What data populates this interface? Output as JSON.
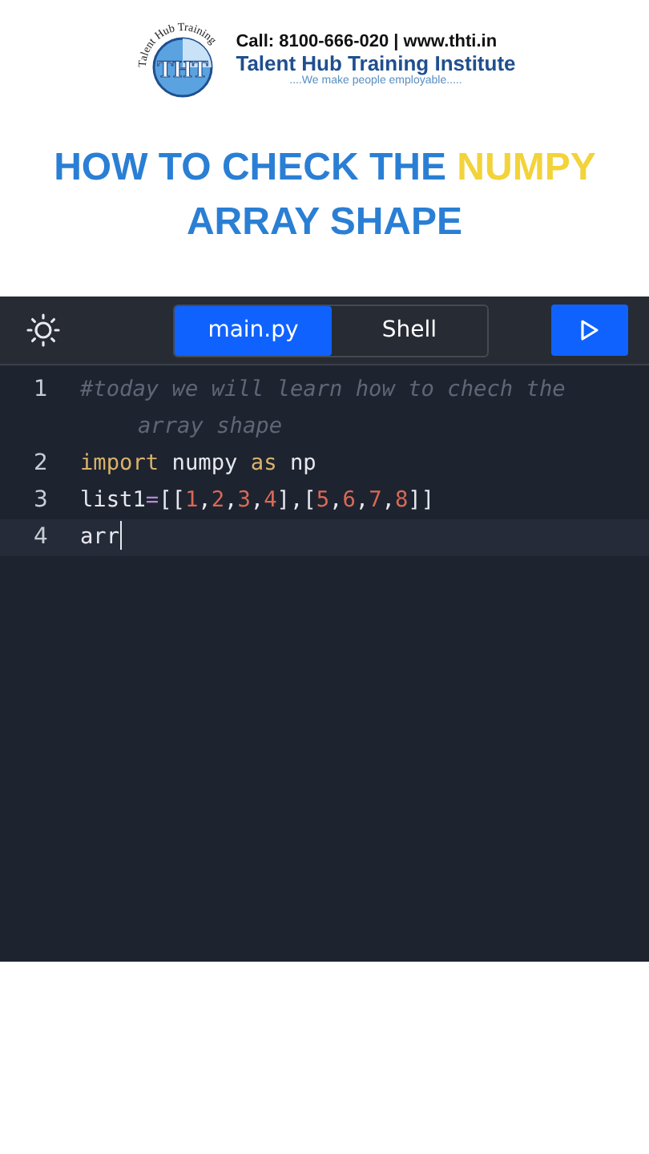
{
  "logo": {
    "arc_text": "Talent Hub Training",
    "monogram": "THT",
    "contact": "Call: 8100-666-020 | www.thti.in",
    "name": "Talent Hub Training Institute",
    "tagline": "....We make people employable....."
  },
  "headline": [
    {
      "text": "HOW TO CHECK THE ",
      "highlight": false
    },
    {
      "text": "NUMPY",
      "highlight": true
    },
    {
      "text": " ARRAY SHAPE",
      "highlight": false
    }
  ],
  "tabs": [
    {
      "label": "main.py",
      "selected": true
    },
    {
      "label": "Shell",
      "selected": false
    }
  ],
  "code_lines": [
    {
      "number": "1",
      "active": false,
      "tokens": [
        {
          "kind": "comment",
          "text": "#today we will learn how to chech the array shape"
        }
      ]
    },
    {
      "number": "2",
      "active": false,
      "tokens": [
        {
          "kind": "keyword",
          "text": "import"
        },
        {
          "kind": "plain",
          "text": " numpy "
        },
        {
          "kind": "keyword",
          "text": "as"
        },
        {
          "kind": "plain",
          "text": " np"
        }
      ]
    },
    {
      "number": "3",
      "active": false,
      "tokens": [
        {
          "kind": "plain",
          "text": "list1"
        },
        {
          "kind": "operator",
          "text": "="
        },
        {
          "kind": "plain",
          "text": "[["
        },
        {
          "kind": "number",
          "text": "1"
        },
        {
          "kind": "plain",
          "text": ","
        },
        {
          "kind": "number",
          "text": "2"
        },
        {
          "kind": "plain",
          "text": ","
        },
        {
          "kind": "number",
          "text": "3"
        },
        {
          "kind": "plain",
          "text": ","
        },
        {
          "kind": "number",
          "text": "4"
        },
        {
          "kind": "plain",
          "text": "],["
        },
        {
          "kind": "number",
          "text": "5"
        },
        {
          "kind": "plain",
          "text": ","
        },
        {
          "kind": "number",
          "text": "6"
        },
        {
          "kind": "plain",
          "text": ","
        },
        {
          "kind": "number",
          "text": "7"
        },
        {
          "kind": "plain",
          "text": ","
        },
        {
          "kind": "number",
          "text": "8"
        },
        {
          "kind": "plain",
          "text": "]]"
        }
      ]
    },
    {
      "number": "4",
      "active": true,
      "tokens": [
        {
          "kind": "plain",
          "text": "arr"
        }
      ]
    }
  ]
}
